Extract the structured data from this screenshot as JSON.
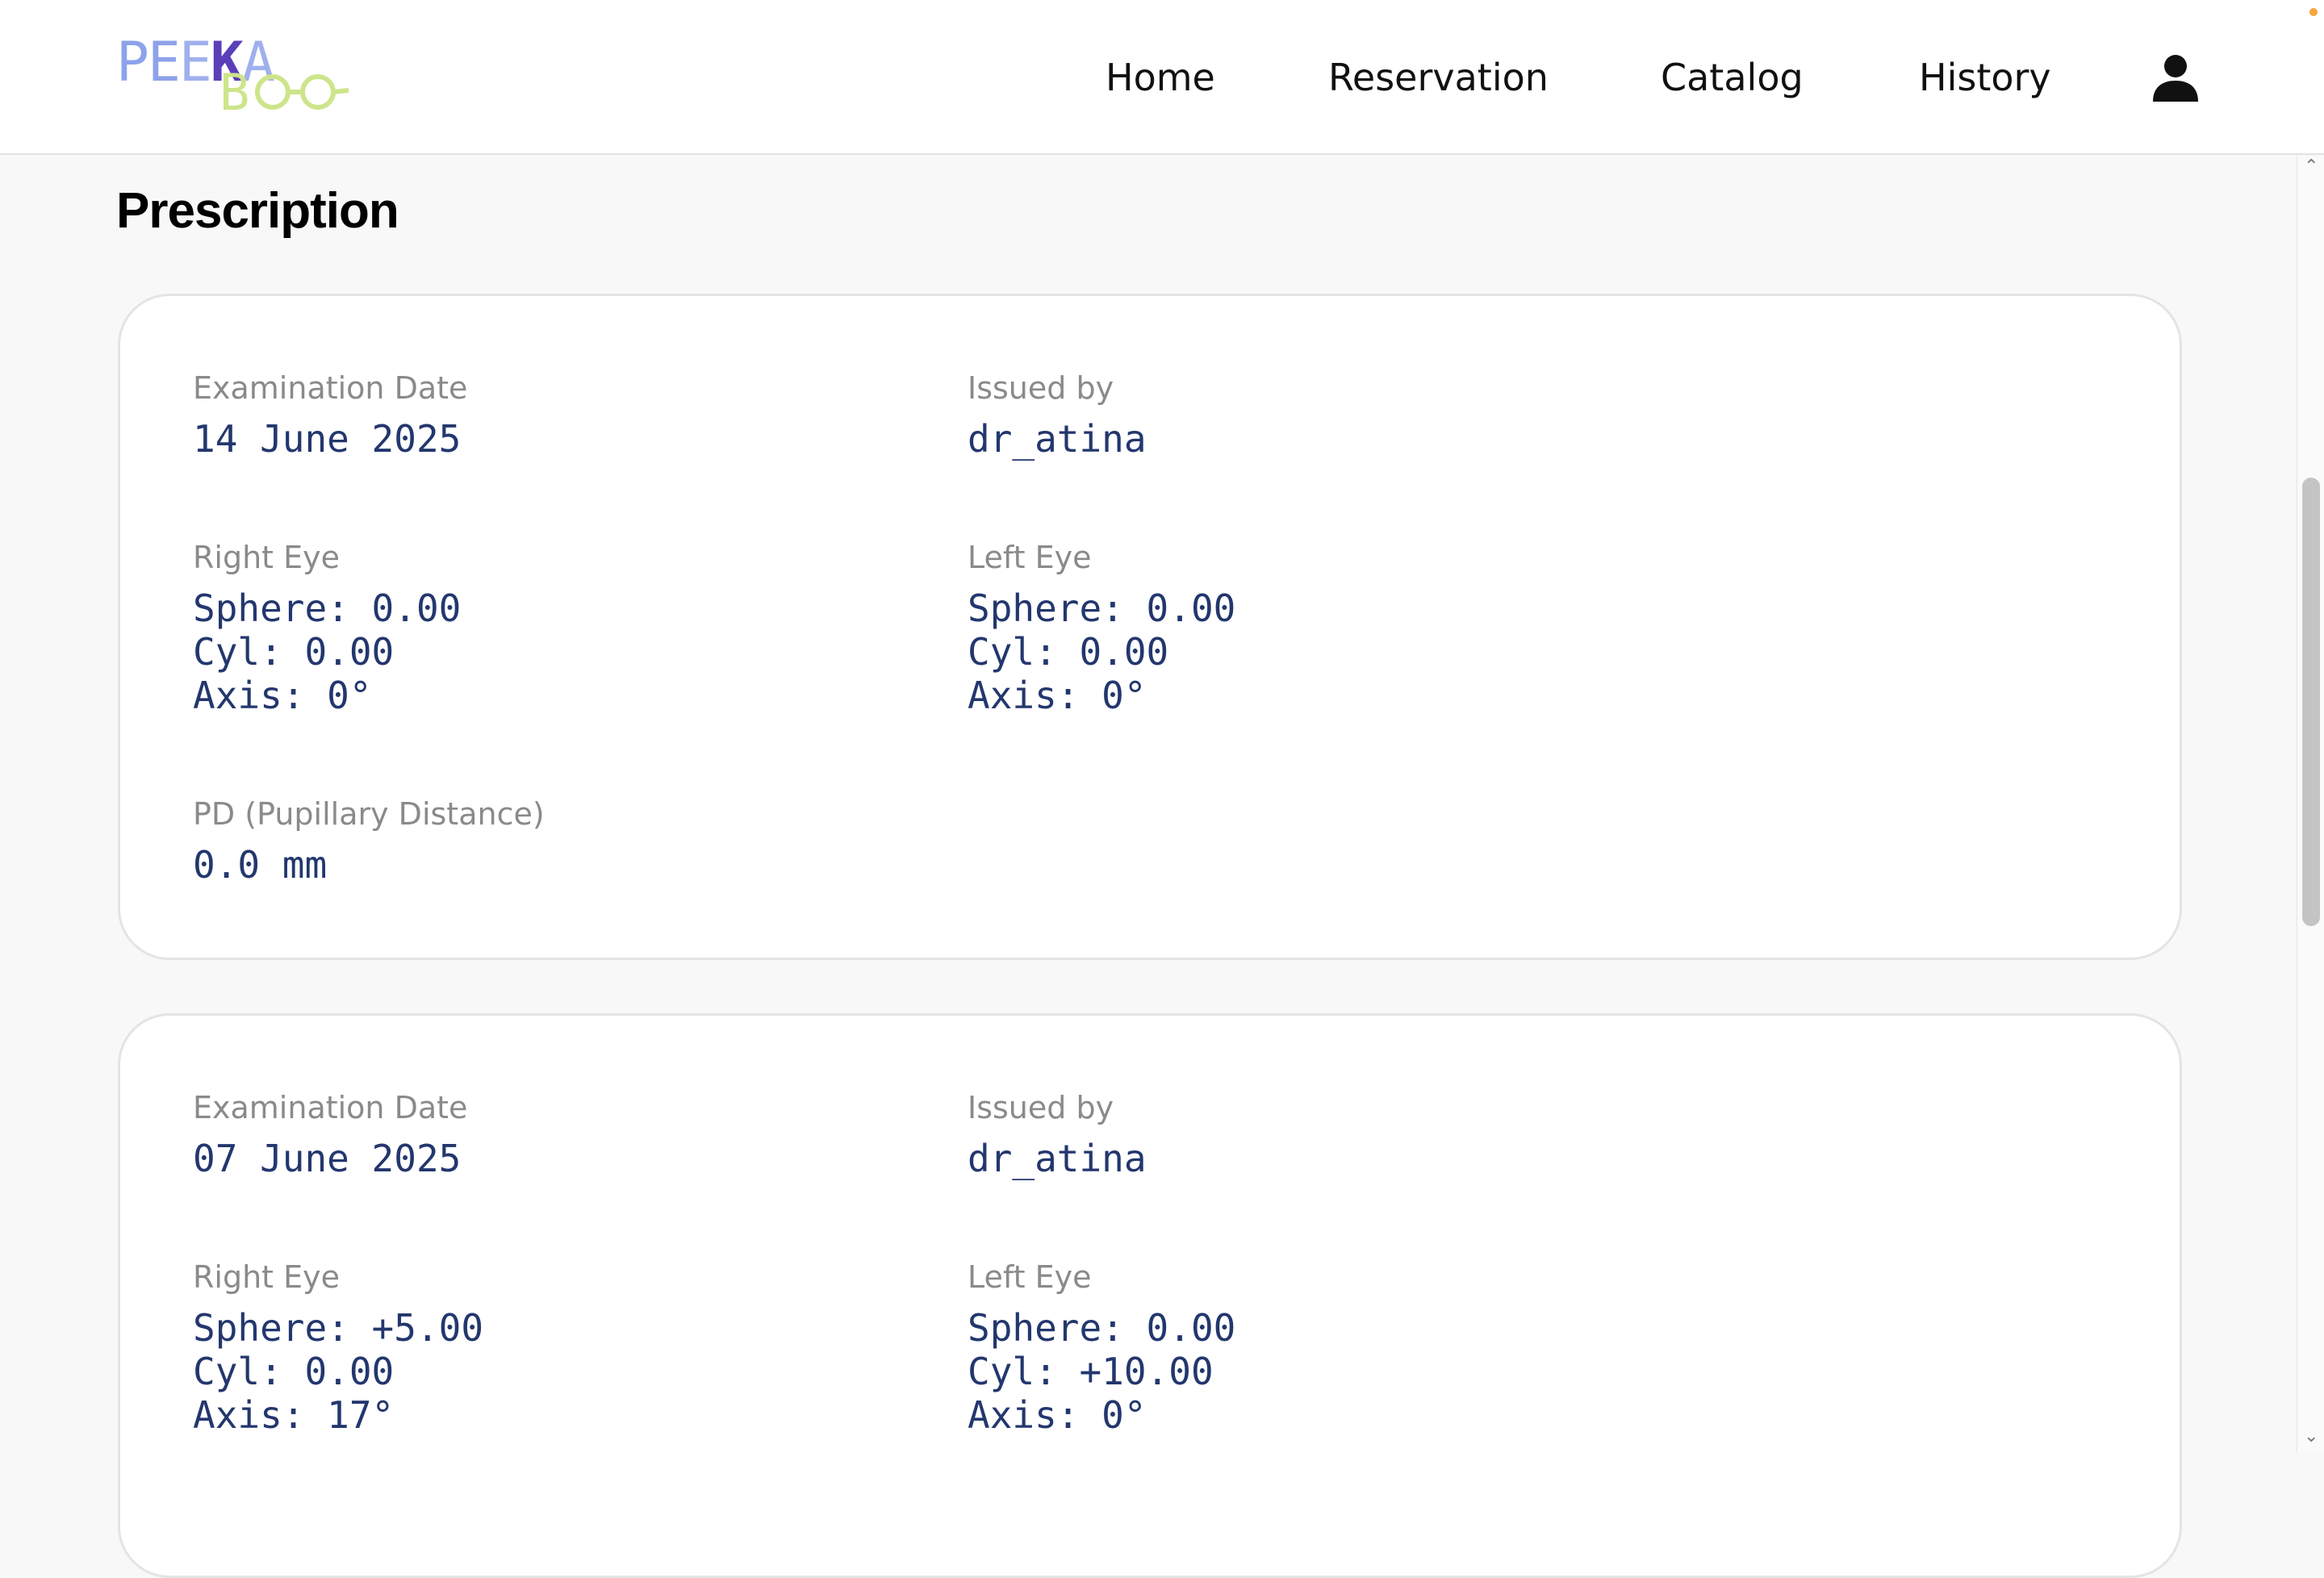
{
  "brand": {
    "logo_part1": "PEEKA",
    "logo_part2": "BOO"
  },
  "nav": {
    "home": "Home",
    "reservation": "Reservation",
    "catalog": "Catalog",
    "history": "History",
    "profile_icon": "user-icon"
  },
  "page": {
    "title": "Prescription"
  },
  "prescriptions": [
    {
      "exam_label": "Examination Date",
      "exam_date": "14 June 2025",
      "issued_label": "Issued by",
      "issued_by": "dr_atina",
      "right_eye_label": "Right Eye",
      "right_sphere": "Sphere: 0.00",
      "right_cyl": "Cyl: 0.00",
      "right_axis": "Axis: 0°",
      "left_eye_label": "Left Eye",
      "left_sphere": "Sphere: 0.00",
      "left_cyl": "Cyl: 0.00",
      "left_axis": "Axis: 0°",
      "pd_label": "PD (Pupillary Distance)",
      "pd_value": "0.0 mm"
    },
    {
      "exam_label": "Examination Date",
      "exam_date": "07 June 2025",
      "issued_label": "Issued by",
      "issued_by": "dr_atina",
      "right_eye_label": "Right Eye",
      "right_sphere": "Sphere: +5.00",
      "right_cyl": "Cyl: 0.00",
      "right_axis": "Axis: 17°",
      "left_eye_label": "Left Eye",
      "left_sphere": "Sphere: 0.00",
      "left_cyl": "Cyl: +10.00",
      "left_axis": "Axis: 0°"
    }
  ],
  "colors": {
    "value_text": "#23376e",
    "label_text": "#8a8a8a",
    "logo_blue": "#8da2ea",
    "logo_purple": "#5b3fb8",
    "logo_lime": "#cde58a"
  }
}
